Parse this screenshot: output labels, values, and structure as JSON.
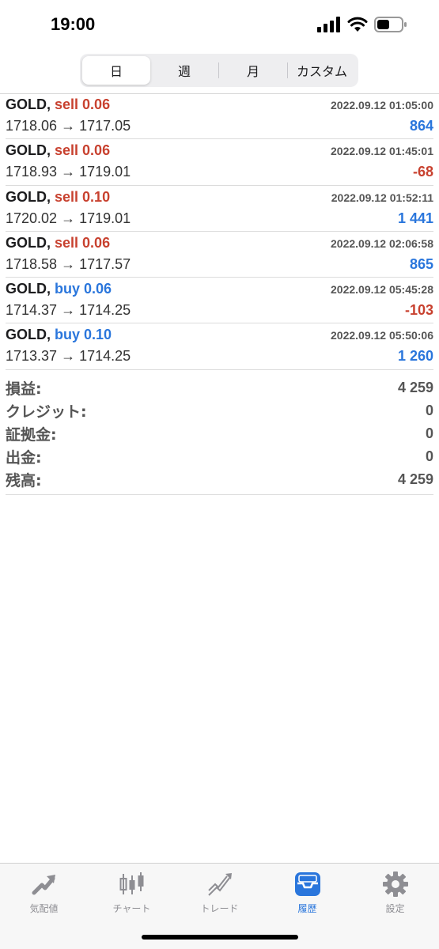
{
  "status": {
    "time": "19:00"
  },
  "segments": [
    {
      "label": "日",
      "active": true
    },
    {
      "label": "週",
      "active": false
    },
    {
      "label": "月",
      "active": false
    },
    {
      "label": "カスタム",
      "active": false
    }
  ],
  "trades": [
    {
      "symbol": "GOLD,",
      "side": "sell",
      "side_label": "sell 0.06",
      "time": "2022.09.12 01:05:00",
      "prices": "1718.06 → 1717.05",
      "profit": "864",
      "profit_sign": "pos"
    },
    {
      "symbol": "GOLD,",
      "side": "sell",
      "side_label": "sell 0.06",
      "time": "2022.09.12 01:45:01",
      "prices": "1718.93 → 1719.01",
      "profit": "-68",
      "profit_sign": "neg"
    },
    {
      "symbol": "GOLD,",
      "side": "sell",
      "side_label": "sell 0.10",
      "time": "2022.09.12 01:52:11",
      "prices": "1720.02 → 1719.01",
      "profit": "1 441",
      "profit_sign": "pos"
    },
    {
      "symbol": "GOLD,",
      "side": "sell",
      "side_label": "sell 0.06",
      "time": "2022.09.12 02:06:58",
      "prices": "1718.58 → 1717.57",
      "profit": "865",
      "profit_sign": "pos"
    },
    {
      "symbol": "GOLD,",
      "side": "buy",
      "side_label": "buy 0.06",
      "time": "2022.09.12 05:45:28",
      "prices": "1714.37 → 1714.25",
      "profit": "-103",
      "profit_sign": "neg"
    },
    {
      "symbol": "GOLD,",
      "side": "buy",
      "side_label": "buy 0.10",
      "time": "2022.09.12 05:50:06",
      "prices": "1713.37 → 1714.25",
      "profit": "1 260",
      "profit_sign": "pos"
    }
  ],
  "summary": [
    {
      "label": "損益:",
      "value": "4 259"
    },
    {
      "label": "クレジット:",
      "value": "0"
    },
    {
      "label": "証拠金:",
      "value": "0"
    },
    {
      "label": "出金:",
      "value": "0"
    },
    {
      "label": "残高:",
      "value": "4 259"
    }
  ],
  "tabs": [
    {
      "label": "気配値",
      "icon": "quotes-arrow-icon",
      "active": false
    },
    {
      "label": "チャート",
      "icon": "candlestick-chart-icon",
      "active": false
    },
    {
      "label": "トレード",
      "icon": "trade-trend-icon",
      "active": false
    },
    {
      "label": "履歴",
      "icon": "history-inbox-icon",
      "active": true
    },
    {
      "label": "設定",
      "icon": "gear-icon",
      "active": false
    }
  ],
  "colors": {
    "sell": "#c8412f",
    "buy": "#2a76dc",
    "profit_positive": "#2a76dc",
    "profit_negative": "#c8412f",
    "tab_active": "#2a76dc"
  }
}
